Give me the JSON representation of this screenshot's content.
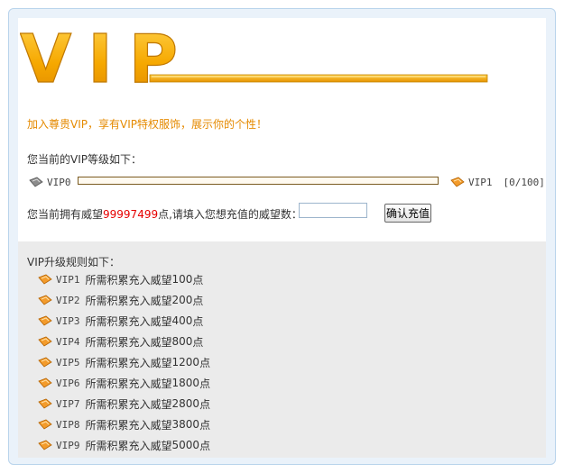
{
  "logo_text": "VIP",
  "tagline": "加入尊贵VIP，享有VIP特权服饰，展示你的个性！",
  "current_label": "您当前的VIP等级如下：",
  "level": {
    "current": "VIP0",
    "next": "VIP1",
    "progress_text": "[0/100]",
    "progress": 0
  },
  "points": {
    "prefix": "您当前拥有威望",
    "value": "99997499",
    "suffix": "点,请填入您想充值的威望数：",
    "input_value": ""
  },
  "confirm_label": "确认充值",
  "rules_title": "VIP升级规则如下：",
  "rule_text": "所需积累充入威望",
  "rule_unit": "点",
  "rules": [
    {
      "level": "VIP1",
      "points": "100"
    },
    {
      "level": "VIP2",
      "points": "200"
    },
    {
      "level": "VIP3",
      "points": "400"
    },
    {
      "level": "VIP4",
      "points": "800"
    },
    {
      "level": "VIP5",
      "points": "1200"
    },
    {
      "level": "VIP6",
      "points": "1800"
    },
    {
      "level": "VIP7",
      "points": "2800"
    },
    {
      "level": "VIP8",
      "points": "3800"
    },
    {
      "level": "VIP9",
      "points": "5000"
    }
  ],
  "colors": {
    "accent": "#e58a00",
    "gold": "#f0a800",
    "red": "#e60000",
    "rules_bg": "#ebebeb"
  }
}
